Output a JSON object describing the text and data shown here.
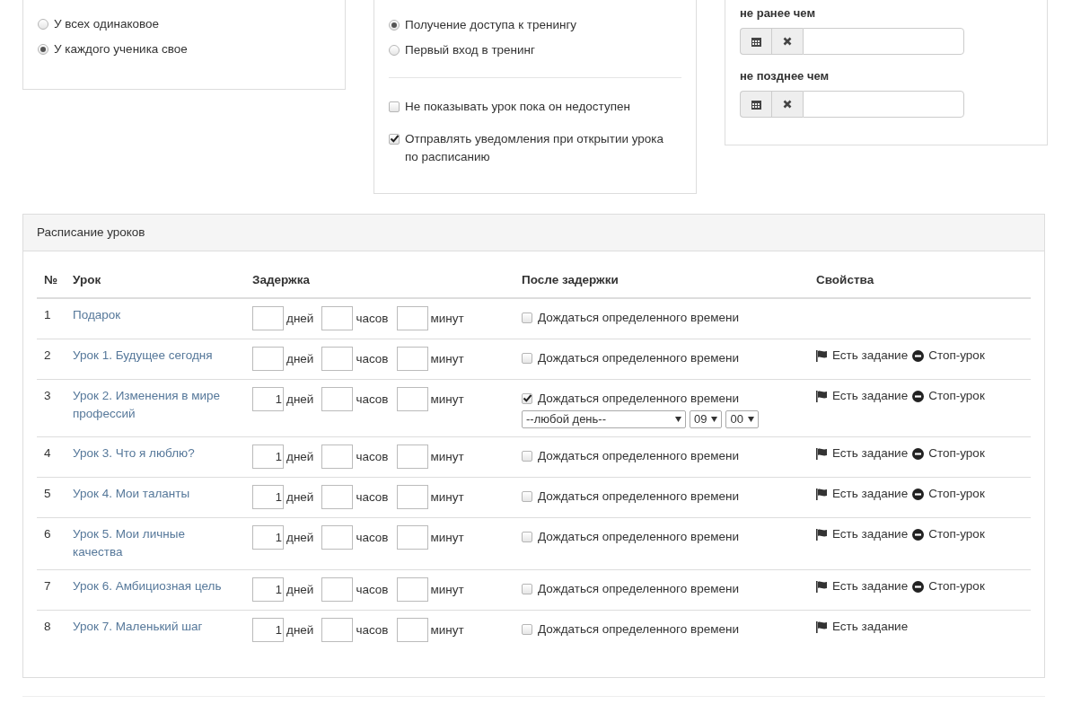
{
  "participation_panel": {
    "options": [
      {
        "label": "У всех одинаковое",
        "selected": false
      },
      {
        "label": "У каждого ученика свое",
        "selected": true
      }
    ]
  },
  "start_panel": {
    "options": [
      {
        "label": "Получение доступа к тренингу",
        "selected": true
      },
      {
        "label": "Первый вход в тренинг",
        "selected": false
      }
    ],
    "checkboxes": [
      {
        "label": "Не показывать урок пока он недоступен",
        "checked": false
      },
      {
        "label": "Отправлять уведомления при открытии урока по расписанию",
        "checked": true
      }
    ]
  },
  "date_panel": {
    "fields": [
      {
        "label": "не ранее чем"
      },
      {
        "label": "не позднее чем"
      }
    ]
  },
  "schedule": {
    "title": "Расписание уроков",
    "columns": [
      "№",
      "Урок",
      "Задержка",
      "После задержки",
      "Свойства"
    ],
    "rows": [
      {
        "num": "1",
        "title": "Подарок",
        "delay": [
          {
            "unit": "дней"
          },
          {
            "unit": "часов"
          },
          {
            "unit": "минут"
          }
        ],
        "wait": {
          "label": "Дождаться определенного времени",
          "checked": false
        },
        "props": []
      },
      {
        "num": "2",
        "title": "Урок 1. Будущее сегодня",
        "delay": [
          {
            "unit": "дней"
          },
          {
            "unit": "часов"
          },
          {
            "unit": "минут"
          }
        ],
        "wait": {
          "label": "Дождаться определенного времени",
          "checked": false
        },
        "props": [
          {
            "kind": "task",
            "label": "Есть задание"
          },
          {
            "kind": "stop",
            "label": "Стоп-урок"
          }
        ]
      },
      {
        "num": "3",
        "title": "Урок 2. Изменения в мире профессий",
        "delay": [
          {
            "value": "1",
            "unit": "дней"
          },
          {
            "unit": "часов"
          },
          {
            "unit": "минут"
          }
        ],
        "wait": {
          "label": "Дождаться определенного времени",
          "checked": true,
          "day": "--любой день--",
          "hour": "09",
          "minute": "00"
        },
        "props": [
          {
            "kind": "task",
            "label": "Есть задание"
          },
          {
            "kind": "stop",
            "label": "Стоп-урок"
          }
        ]
      },
      {
        "num": "4",
        "title": "Урок 3. Что я люблю?",
        "delay": [
          {
            "value": "1",
            "unit": "дней"
          },
          {
            "unit": "часов"
          },
          {
            "unit": "минут"
          }
        ],
        "wait": {
          "label": "Дождаться определенного времени",
          "checked": false
        },
        "props": [
          {
            "kind": "task",
            "label": "Есть задание"
          },
          {
            "kind": "stop",
            "label": "Стоп-урок"
          }
        ]
      },
      {
        "num": "5",
        "title": "Урок 4. Мои таланты",
        "delay": [
          {
            "value": "1",
            "unit": "дней"
          },
          {
            "unit": "часов"
          },
          {
            "unit": "минут"
          }
        ],
        "wait": {
          "label": "Дождаться определенного времени",
          "checked": false
        },
        "props": [
          {
            "kind": "task",
            "label": "Есть задание"
          },
          {
            "kind": "stop",
            "label": "Стоп-урок"
          }
        ]
      },
      {
        "num": "6",
        "title": "Урок 5. Мои личные качества",
        "delay": [
          {
            "value": "1",
            "unit": "дней"
          },
          {
            "unit": "часов"
          },
          {
            "unit": "минут"
          }
        ],
        "wait": {
          "label": "Дождаться определенного времени",
          "checked": false
        },
        "props": [
          {
            "kind": "task",
            "label": "Есть задание"
          },
          {
            "kind": "stop",
            "label": "Стоп-урок"
          }
        ]
      },
      {
        "num": "7",
        "title": "Урок 6. Амбициозная цель",
        "delay": [
          {
            "value": "1",
            "unit": "дней"
          },
          {
            "unit": "часов"
          },
          {
            "unit": "минут"
          }
        ],
        "wait": {
          "label": "Дождаться определенного времени",
          "checked": false
        },
        "props": [
          {
            "kind": "task",
            "label": "Есть задание"
          },
          {
            "kind": "stop",
            "label": "Стоп-урок"
          }
        ]
      },
      {
        "num": "8",
        "title": "Урок 7. Маленький шаг",
        "delay": [
          {
            "value": "1",
            "unit": "дней"
          },
          {
            "unit": "часов"
          },
          {
            "unit": "минут"
          }
        ],
        "wait": {
          "label": "Дождаться определенного времени",
          "checked": false
        },
        "props": [
          {
            "kind": "task",
            "label": "Есть задание"
          }
        ]
      }
    ]
  }
}
